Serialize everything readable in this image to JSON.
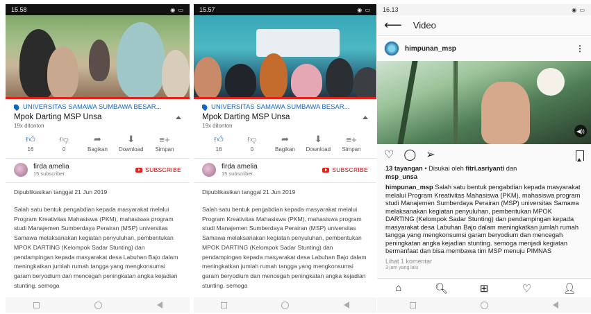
{
  "yt": {
    "location": "UNIVERSITAS SAMAWA SUMBAWA BESAR...",
    "title": "Mpok Darting MSP Unsa",
    "views": "19x ditonton",
    "likes": "16",
    "dislikes": "0",
    "share_label": "Bagikan",
    "download_label": "Download",
    "save_label": "Simpan",
    "channel_name": "firda amelia",
    "channel_subs": "15 subscriber",
    "subscribe_label": "SUBSCRIBE",
    "published": "Dipublikasikan tanggal 21 Jun 2019",
    "description": "Salah satu bentuk pengabdian kepada masyarakat melalui Program Kreativitas Mahasiswa (PKM), mahasiswa program studi Manajemen Sumberdaya Perairan (MSP) universitas Samawa melaksanakan kegiatan penyuluhan, pembentukan MPOK DARTING (Kelompok Sadar Stunting) dan pendampingan kepada masyarakat desa Labuhan Bajo dalam meningkatkan jumlah rumah tangga yang mengkonsumsi garam beryodium dan mencegah peningkatan angka kejadian stunting. semoga",
    "progress_percent": 100
  },
  "phone1": {
    "time": "15.58"
  },
  "phone2": {
    "time": "15.57"
  },
  "ig": {
    "time": "16.13",
    "header_title": "Video",
    "username": "himpunan_msp",
    "views": "13 tayangan",
    "liked_by_prefix": " • Disukai oleh ",
    "liked_by_user": "fitri.asriyanti",
    "liked_by_and": " dan",
    "liked_by_user2": "msp_unsa",
    "caption_user": "himpunan_msp",
    "caption": " Salah satu bentuk pengabdian kepada masyarakat melalui Program Kreativitas Mahasiswa (PKM), mahasiswa program studi Manajemen Sumberdaya Perairan (MSP) universitas Samawa melaksanakan kegiatan penyuluhan, pembentukan MPOK DARTING (Kelompok Sadar Stunting) dan pendampingan kepada masyarakat desa Labuhan Bajo dalam meningkatkan jumlah rumah tangga yang mengkonsumsi garam beryodium dan mencegah peningkatan angka kejadian stunting. semoga menjadi kegiatan bermanfaat dan bisa membawa tim MSP menuju PIMNAS",
    "comments": "Lihat 1 komentar",
    "posted": "3 jam yang lalu"
  }
}
